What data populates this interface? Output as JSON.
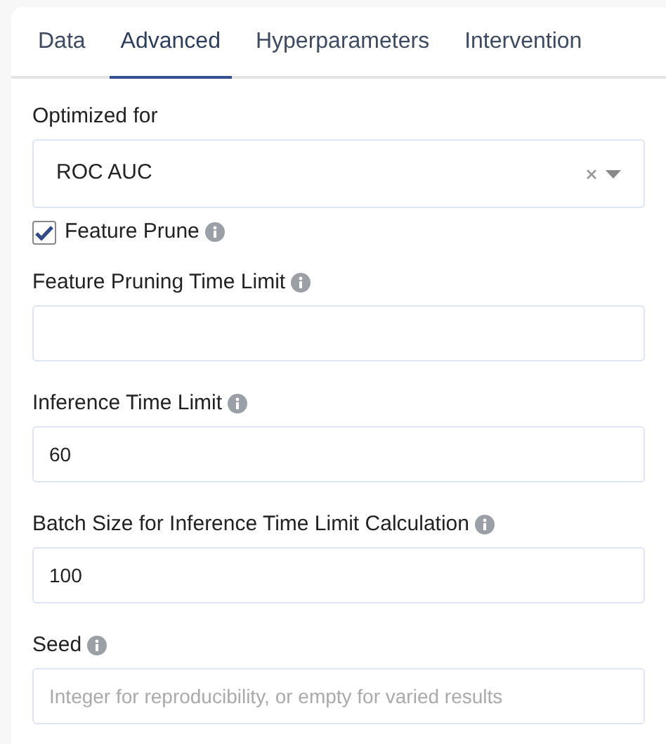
{
  "tabs": [
    {
      "label": "Data",
      "selected": false
    },
    {
      "label": "Advanced",
      "selected": true
    },
    {
      "label": "Hyperparameters",
      "selected": false
    },
    {
      "label": "Intervention",
      "selected": false
    }
  ],
  "fields": [
    {
      "kind": "select",
      "label": "Optimized for",
      "info": false,
      "value": "ROC AUC",
      "clearable": true
    },
    {
      "kind": "checkbox",
      "label": "Feature Prune",
      "info": true,
      "checked": true
    },
    {
      "kind": "input",
      "label": "Feature Pruning Time Limit",
      "info": true
    },
    {
      "kind": "input",
      "label": "Inference Time Limit",
      "info": true,
      "value": "60"
    },
    {
      "kind": "input",
      "label": "Batch Size for Inference Time Limit Calculation",
      "info": true,
      "value": "100"
    },
    {
      "kind": "input",
      "label": "Seed",
      "info": true,
      "placeholder": "Integer for reproducibility, or empty for varied results"
    }
  ]
}
